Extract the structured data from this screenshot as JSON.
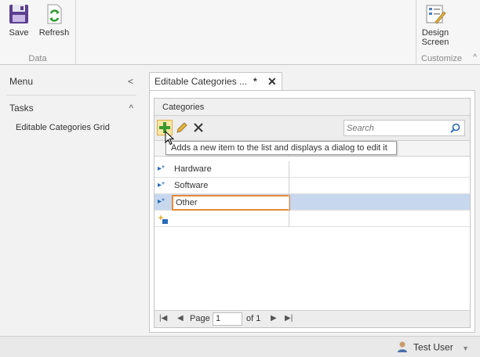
{
  "ribbon": {
    "groups": {
      "data": {
        "label": "Data",
        "buttons": {
          "save": "Save",
          "refresh": "Refresh"
        }
      },
      "customize": {
        "label": "Customize",
        "buttons": {
          "design_line1": "Design",
          "design_line2": "Screen"
        }
      }
    },
    "collapse_glyph": "^"
  },
  "nav": {
    "menu_label": "Menu",
    "menu_chevron": "<",
    "tasks_label": "Tasks",
    "tasks_chevron": "^",
    "items": [
      {
        "label": "Editable Categories Grid"
      }
    ]
  },
  "document": {
    "tab_title": "Editable Categories ...",
    "tab_dirty": "*",
    "tab_close": "✕",
    "section_title": "Categories",
    "search_placeholder": "Search",
    "tooltip": "Adds a new item to the list and displays a dialog to edit it",
    "rows": [
      {
        "name": "Hardware",
        "indicator": "▸*"
      },
      {
        "name": "Software",
        "indicator": "▸*"
      },
      {
        "name": "Other",
        "indicator": "▸*",
        "selected": true,
        "editing": true
      }
    ],
    "pager": {
      "page_label": "Page",
      "page_value": "1",
      "of_label": "of 1"
    }
  },
  "status": {
    "user": "Test User"
  },
  "colors": {
    "edit_border": "#e58a3a",
    "selected_row": "#c7d8ee",
    "add_button_bg": "#fbe6a6"
  }
}
